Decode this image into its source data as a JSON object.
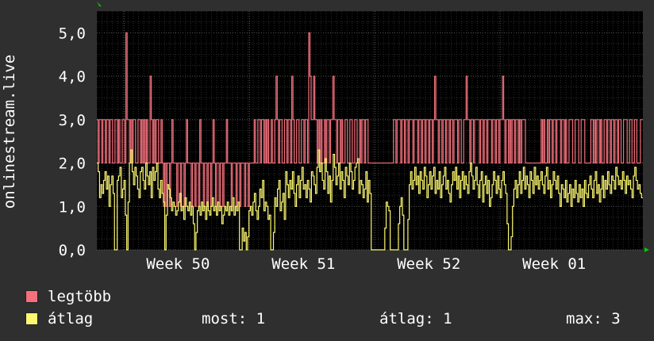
{
  "colors": {
    "background": "#2f2f2f",
    "plot_background": "#000000",
    "grid_major": "#5a5a5a",
    "grid_minor": "#2c2c2c",
    "max_series": "#f3707c",
    "avg_series": "#fdf870",
    "axis_arrow": "#00c800",
    "text": "#ffffff"
  },
  "chart_data": {
    "type": "line",
    "ylabel": "onlinestream.live",
    "ylim": [
      0,
      5.5
    ],
    "y_ticks": [
      "0,0",
      "1,0",
      "2,0",
      "3,0",
      "4,0",
      "5,0"
    ],
    "x_ticks": [
      "Week 50",
      "Week 51",
      "Week 52",
      "Week 01"
    ],
    "xlim": [
      0,
      440
    ],
    "x_tick_positions": [
      22,
      123,
      224,
      325
    ],
    "grid": true,
    "series": [
      {
        "name": "legtöbb",
        "color": "#f3707c",
        "values": [
          3,
          2,
          3,
          3,
          2,
          3,
          3,
          2,
          3,
          3,
          2,
          3,
          3,
          2,
          2,
          3,
          3,
          2,
          3,
          2,
          2,
          3,
          3,
          2,
          5,
          3,
          3,
          2,
          3,
          2,
          3,
          3,
          2,
          2,
          3,
          3,
          2,
          3,
          2,
          3,
          2,
          3,
          2,
          2,
          4,
          3,
          2,
          3,
          2,
          3,
          3,
          2,
          2,
          3,
          2,
          1,
          2,
          1,
          2,
          2,
          1,
          2,
          3,
          2,
          2,
          2,
          1,
          2,
          2,
          1,
          2,
          2,
          1,
          2,
          3,
          2,
          2,
          2,
          1,
          2,
          2,
          1,
          2,
          2,
          1,
          3,
          2,
          2,
          1,
          2,
          2,
          1,
          2,
          2,
          1,
          2,
          3,
          2,
          1,
          2,
          2,
          1,
          2,
          2,
          1,
          2,
          2,
          3,
          2,
          2,
          2,
          1,
          2,
          2,
          2,
          1,
          2,
          2,
          1,
          2,
          2,
          2,
          1,
          2,
          2,
          1,
          2,
          2,
          2,
          2,
          3,
          2,
          2,
          3,
          3,
          2,
          3,
          3,
          2,
          3,
          2,
          3,
          2,
          2,
          3,
          2,
          2,
          3,
          4,
          3,
          2,
          3,
          3,
          2,
          2,
          3,
          3,
          2,
          3,
          3,
          2,
          4,
          3,
          2,
          2,
          3,
          3,
          2,
          2,
          3,
          3,
          2,
          3,
          3,
          2,
          5,
          4,
          3,
          3,
          4,
          3,
          3,
          2,
          3,
          2,
          3,
          2,
          2,
          3,
          2,
          3,
          3,
          2,
          3,
          3,
          4,
          3,
          3,
          2,
          3,
          3,
          2,
          3,
          2,
          2,
          3,
          3,
          2,
          2,
          3,
          3,
          2,
          2,
          3,
          3,
          2,
          2,
          3,
          2,
          3,
          3,
          2,
          3,
          3,
          2,
          2,
          2,
          2,
          2,
          2,
          2,
          2,
          2,
          2,
          2,
          2,
          2,
          2,
          2,
          2,
          2,
          2,
          2,
          2,
          2,
          3,
          3,
          2,
          3,
          3,
          3,
          2,
          3,
          3,
          2,
          3,
          3,
          2,
          3,
          3,
          3,
          2,
          3,
          3,
          3,
          2,
          3,
          3,
          2,
          3,
          3,
          2,
          3,
          3,
          2,
          3,
          3,
          2,
          3,
          4,
          3,
          3,
          2,
          3,
          3,
          2,
          3,
          3,
          2,
          3,
          3,
          2,
          3,
          3,
          2,
          3,
          3,
          3,
          2,
          3,
          3,
          2,
          2,
          3,
          3,
          4,
          3,
          3,
          2,
          3,
          3,
          2,
          3,
          3,
          3,
          3,
          2,
          3,
          3,
          2,
          3,
          3,
          2,
          3,
          3,
          3,
          2,
          3,
          3,
          2,
          3,
          3,
          2,
          3,
          3,
          4,
          3,
          2,
          3,
          3,
          2,
          3,
          2,
          3,
          3,
          2,
          3,
          3,
          2,
          3,
          2,
          3,
          3,
          3,
          2,
          2,
          2,
          2,
          2,
          2,
          2,
          2,
          2,
          2,
          2,
          2,
          2,
          3,
          2,
          3,
          2,
          2,
          3,
          2,
          3,
          3,
          2,
          3,
          3,
          2,
          3,
          3,
          3,
          2,
          3,
          3,
          2,
          3,
          2,
          2,
          3,
          3,
          3,
          2,
          2,
          3,
          3,
          3,
          2,
          2,
          3,
          3,
          3,
          2,
          2,
          2,
          2,
          2,
          3,
          3,
          2,
          3,
          2,
          3,
          3,
          2,
          3,
          2,
          2,
          3,
          3,
          2,
          3,
          3,
          2,
          3,
          3,
          2,
          3,
          3,
          2,
          3,
          3,
          2,
          2,
          3,
          3,
          3,
          2,
          2,
          3,
          3,
          2,
          2,
          3,
          3,
          2,
          2,
          2,
          3,
          3
        ]
      },
      {
        "name": "átlag",
        "color": "#fdf870",
        "values": [
          2.0,
          1.8,
          1.2,
          1.5,
          1.3,
          1.6,
          1.8,
          1.4,
          1.7,
          1.0,
          1.5,
          1.7,
          1.3,
          0.0,
          0.0,
          1.6,
          1.7,
          1.9,
          1.2,
          1.4,
          1.6,
          0.8,
          0.0,
          1.1,
          2.0,
          2.3,
          1.8,
          1.5,
          1.9,
          1.7,
          1.4,
          1.2,
          1.8,
          1.9,
          1.6,
          1.4,
          2.0,
          1.7,
          1.5,
          1.8,
          1.2,
          1.9,
          1.6,
          1.8,
          2.0,
          1.4,
          1.2,
          1.6,
          1.3,
          1.1,
          0.0,
          0.8,
          1.5,
          1.4,
          1.2,
          0.9,
          1.1,
          1.0,
          0.8,
          0.9,
          1.1,
          1.3,
          0.9,
          1.0,
          0.7,
          1.2,
          1.0,
          0.9,
          1.1,
          0.8,
          1.0,
          0.6,
          0.0,
          0.4,
          0.9,
          1.0,
          0.8,
          1.1,
          0.9,
          1.0,
          0.7,
          1.1,
          0.9,
          0.8,
          1.0,
          1.2,
          0.9,
          1.0,
          0.8,
          1.1,
          0.9,
          1.0,
          0.6,
          0.8,
          1.0,
          0.9,
          1.1,
          0.8,
          1.0,
          0.9,
          1.2,
          0.8,
          1.0,
          0.9,
          1.1,
          0.0,
          0.0,
          0.5,
          0.2,
          0.4,
          0.0,
          0.3,
          0.9,
          1.0,
          0.8,
          1.1,
          1.3,
          0.9,
          0.7,
          1.0,
          1.4,
          1.2,
          1.6,
          0.9,
          1.1,
          1.0,
          0.7,
          0.8,
          0.0,
          0.0,
          0.4,
          1.2,
          1.0,
          1.4,
          1.6,
          0.9,
          1.1,
          1.3,
          0.7,
          1.8,
          1.5,
          1.2,
          1.6,
          1.4,
          1.8,
          1.3,
          1.0,
          1.5,
          1.7,
          1.2,
          1.6,
          1.9,
          1.4,
          1.5,
          1.2,
          1.6,
          1.4,
          1.1,
          1.8,
          1.7,
          1.5,
          1.3,
          1.9,
          2.3,
          1.8,
          2.0,
          1.6,
          1.4,
          2.1,
          1.8,
          1.3,
          1.7,
          1.1,
          1.6,
          2.2,
          1.9,
          1.5,
          1.7,
          2.0,
          1.4,
          1.8,
          1.6,
          1.2,
          1.9,
          1.7,
          1.5,
          2.0,
          1.8,
          1.4,
          1.6,
          1.9,
          2.0,
          2.1,
          1.3,
          1.6,
          1.5,
          1.2,
          1.4,
          1.8,
          1.1,
          1.6,
          1.3,
          0.0,
          0.0,
          0.0,
          0.0,
          0.0,
          0.0,
          0.0,
          0.0,
          0.0,
          0.0,
          0.5,
          1.1,
          1.0,
          0.9,
          0.0,
          0.0,
          0.0,
          0.0,
          0.0,
          0.0,
          0.6,
          1.0,
          1.2,
          0.8,
          0.0,
          0.0,
          0.0,
          0.7,
          1.5,
          1.8,
          1.4,
          1.6,
          1.9,
          1.5,
          1.7,
          1.3,
          1.8,
          1.6,
          1.4,
          1.9,
          1.7,
          1.2,
          1.5,
          1.8,
          1.4,
          1.7,
          1.9,
          1.3,
          1.6,
          1.4,
          1.8,
          1.2,
          1.5,
          1.7,
          1.9,
          1.4,
          1.6,
          1.3,
          1.1,
          1.5,
          1.8,
          1.6,
          1.9,
          1.4,
          1.7,
          1.2,
          1.6,
          1.8,
          1.4,
          1.7,
          1.5,
          1.3,
          1.8,
          2.0,
          1.7,
          1.4,
          1.6,
          1.9,
          1.5,
          1.2,
          1.6,
          1.8,
          1.1,
          1.5,
          1.7,
          1.3,
          1.6,
          1.0,
          1.2,
          1.5,
          1.8,
          1.6,
          1.3,
          1.7,
          1.4,
          1.2,
          1.6,
          1.8,
          1.5,
          1.3,
          0.6,
          0.0,
          0.0,
          0.3,
          1.0,
          1.4,
          1.6,
          1.2,
          1.5,
          1.8,
          1.3,
          1.6,
          1.9,
          1.4,
          1.7,
          1.5,
          1.2,
          1.8,
          1.6,
          1.3,
          1.9,
          1.5,
          1.7,
          1.4,
          1.6,
          1.8,
          1.5,
          1.3,
          1.7,
          1.9,
          1.4,
          1.6,
          1.2,
          1.5,
          1.8,
          1.6,
          1.4,
          1.7,
          1.3,
          1.0,
          1.5,
          1.4,
          1.2,
          1.6,
          1.1,
          1.3,
          1.5,
          1.0,
          1.4,
          1.2,
          1.6,
          1.3,
          1.1,
          1.5,
          1.2,
          1.4,
          1.0,
          1.6,
          1.3,
          1.2,
          1.5,
          1.7,
          1.4,
          1.2,
          1.6,
          1.8,
          1.3,
          1.5,
          1.1,
          1.4,
          1.7,
          1.2,
          1.6,
          1.4,
          1.8,
          1.5,
          1.3,
          1.7,
          1.6,
          1.4,
          1.9,
          1.7,
          1.5,
          1.6,
          1.4,
          1.8,
          1.6,
          1.3,
          1.7,
          1.5,
          1.6,
          1.4,
          1.2,
          1.7,
          1.9,
          1.6,
          1.4,
          1.5,
          1.3,
          1.2
        ]
      }
    ]
  },
  "legend": {
    "items": [
      {
        "label": "legtöbb",
        "color": "#f3707c"
      },
      {
        "label": "átlag",
        "color": "#fdf870"
      }
    ],
    "current": "most: 1",
    "average": "átlag: 1",
    "maximum": "max: 3"
  }
}
